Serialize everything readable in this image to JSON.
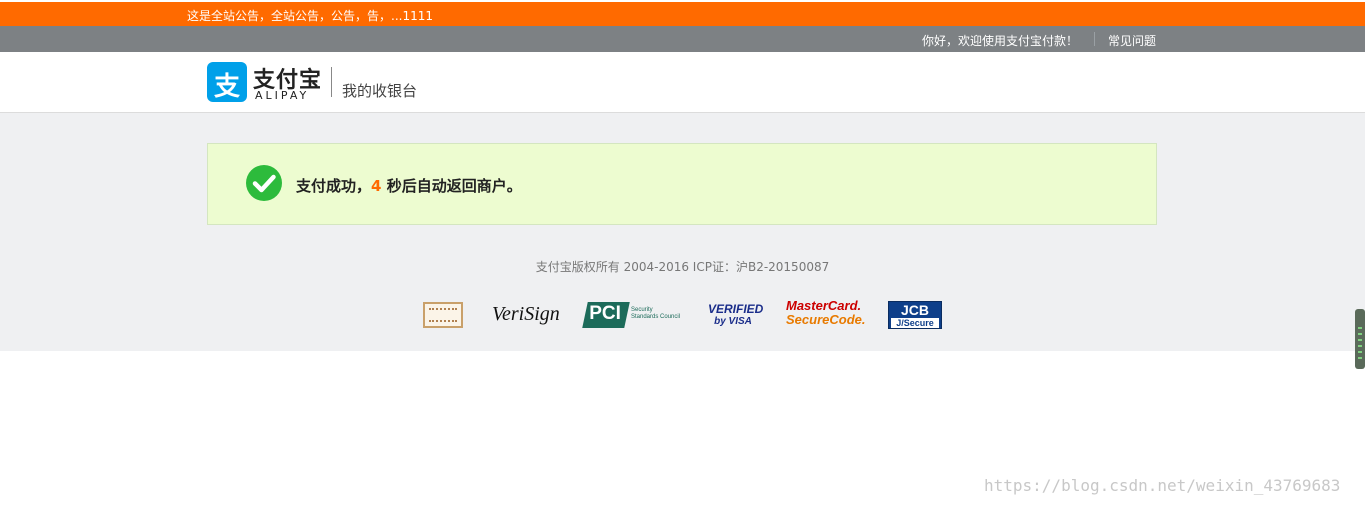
{
  "notice_bar": {
    "text": "这是全站公告，全站公告，公告，告，...1111"
  },
  "top_nav": {
    "welcome": "你好，欢迎使用支付宝付款！",
    "faq_link": "常见问题"
  },
  "header": {
    "logo_icon_char": "支",
    "logo_name": "支付宝",
    "logo_english": "ALIPAY",
    "page_title": "我的收银台"
  },
  "success": {
    "prefix": "支付成功，",
    "seconds": "4",
    "suffix": "秒后自动返回商户。"
  },
  "footer": {
    "copyright": "支付宝版权所有 2004-2016 ICP证：沪B2-20150087",
    "badges": {
      "verisign": "VeriSign",
      "pci": "PCI",
      "pci_sub_1": "Security",
      "pci_sub_2": "Standards Council",
      "visa_1": "VERIFIED",
      "visa_2": "by VISA",
      "mastercard_1": "MasterCard.",
      "mastercard_2": "SecureCode.",
      "jcb_1": "JCB",
      "jcb_2": "J/Secure"
    }
  },
  "watermark": "https://blog.csdn.net/weixin_43769683",
  "colors": {
    "notice_bg": "#ff6a00",
    "nav_bg": "#7d8184",
    "brand_blue": "#00a0e9",
    "success_green": "#2dbb3c",
    "accent_orange": "#ff6a00"
  }
}
